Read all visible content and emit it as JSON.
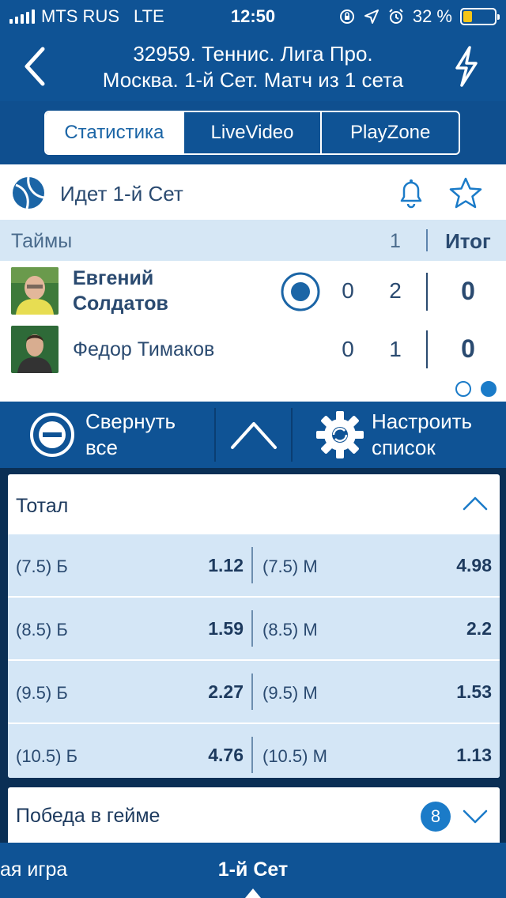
{
  "status_bar": {
    "carrier": "MTS RUS",
    "network": "LTE",
    "time": "12:50",
    "battery": "32 %"
  },
  "header": {
    "title_line1": "32959. Теннис. Лига Про.",
    "title_line2": "Москва. 1-й  Сет. Матч из 1 сета"
  },
  "tabs": [
    {
      "label": "Статистика",
      "active": true
    },
    {
      "label": "LiveVideo",
      "active": false
    },
    {
      "label": "PlayZone",
      "active": false
    }
  ],
  "match": {
    "status": "Идет 1-й  Сет",
    "periods_label": "Таймы",
    "period_1": "1",
    "total_label": "Итог",
    "players": [
      {
        "name_line1": "Евгений",
        "name_line2": "Солдатов",
        "game": "0",
        "set1": "2",
        "total": "0",
        "serving": true
      },
      {
        "name_line1": "Федор Тимаков",
        "name_line2": "",
        "game": "0",
        "set1": "1",
        "total": "0",
        "serving": false
      }
    ],
    "pages": 2,
    "active_page": 2
  },
  "toolbar": {
    "collapse_line1": "Свернуть",
    "collapse_line2": "все",
    "settings_line1": "Настроить",
    "settings_line2": "список"
  },
  "markets": {
    "total": {
      "title": "Тотал",
      "rows": [
        {
          "over_label": "(7.5) Б",
          "over_odds": "1.12",
          "under_label": "(7.5) М",
          "under_odds": "4.98"
        },
        {
          "over_label": "(8.5) Б",
          "over_odds": "1.59",
          "under_label": "(8.5) М",
          "under_odds": "2.2"
        },
        {
          "over_label": "(9.5) Б",
          "over_odds": "2.27",
          "under_label": "(9.5) М",
          "under_odds": "1.53"
        },
        {
          "over_label": "(10.5) Б",
          "over_odds": "4.76",
          "under_label": "(10.5) М",
          "under_odds": "1.13"
        }
      ]
    },
    "game_win": {
      "title": "Победа в гейме",
      "count": "8"
    }
  },
  "bottom_tabs": {
    "prev": "ая игра",
    "active": "1-й  Сет"
  },
  "colors": {
    "primary": "#0f5395",
    "accent": "#1b7bc8",
    "odds_bg": "#d4e6f6",
    "battery_fill": "#f5c518"
  }
}
